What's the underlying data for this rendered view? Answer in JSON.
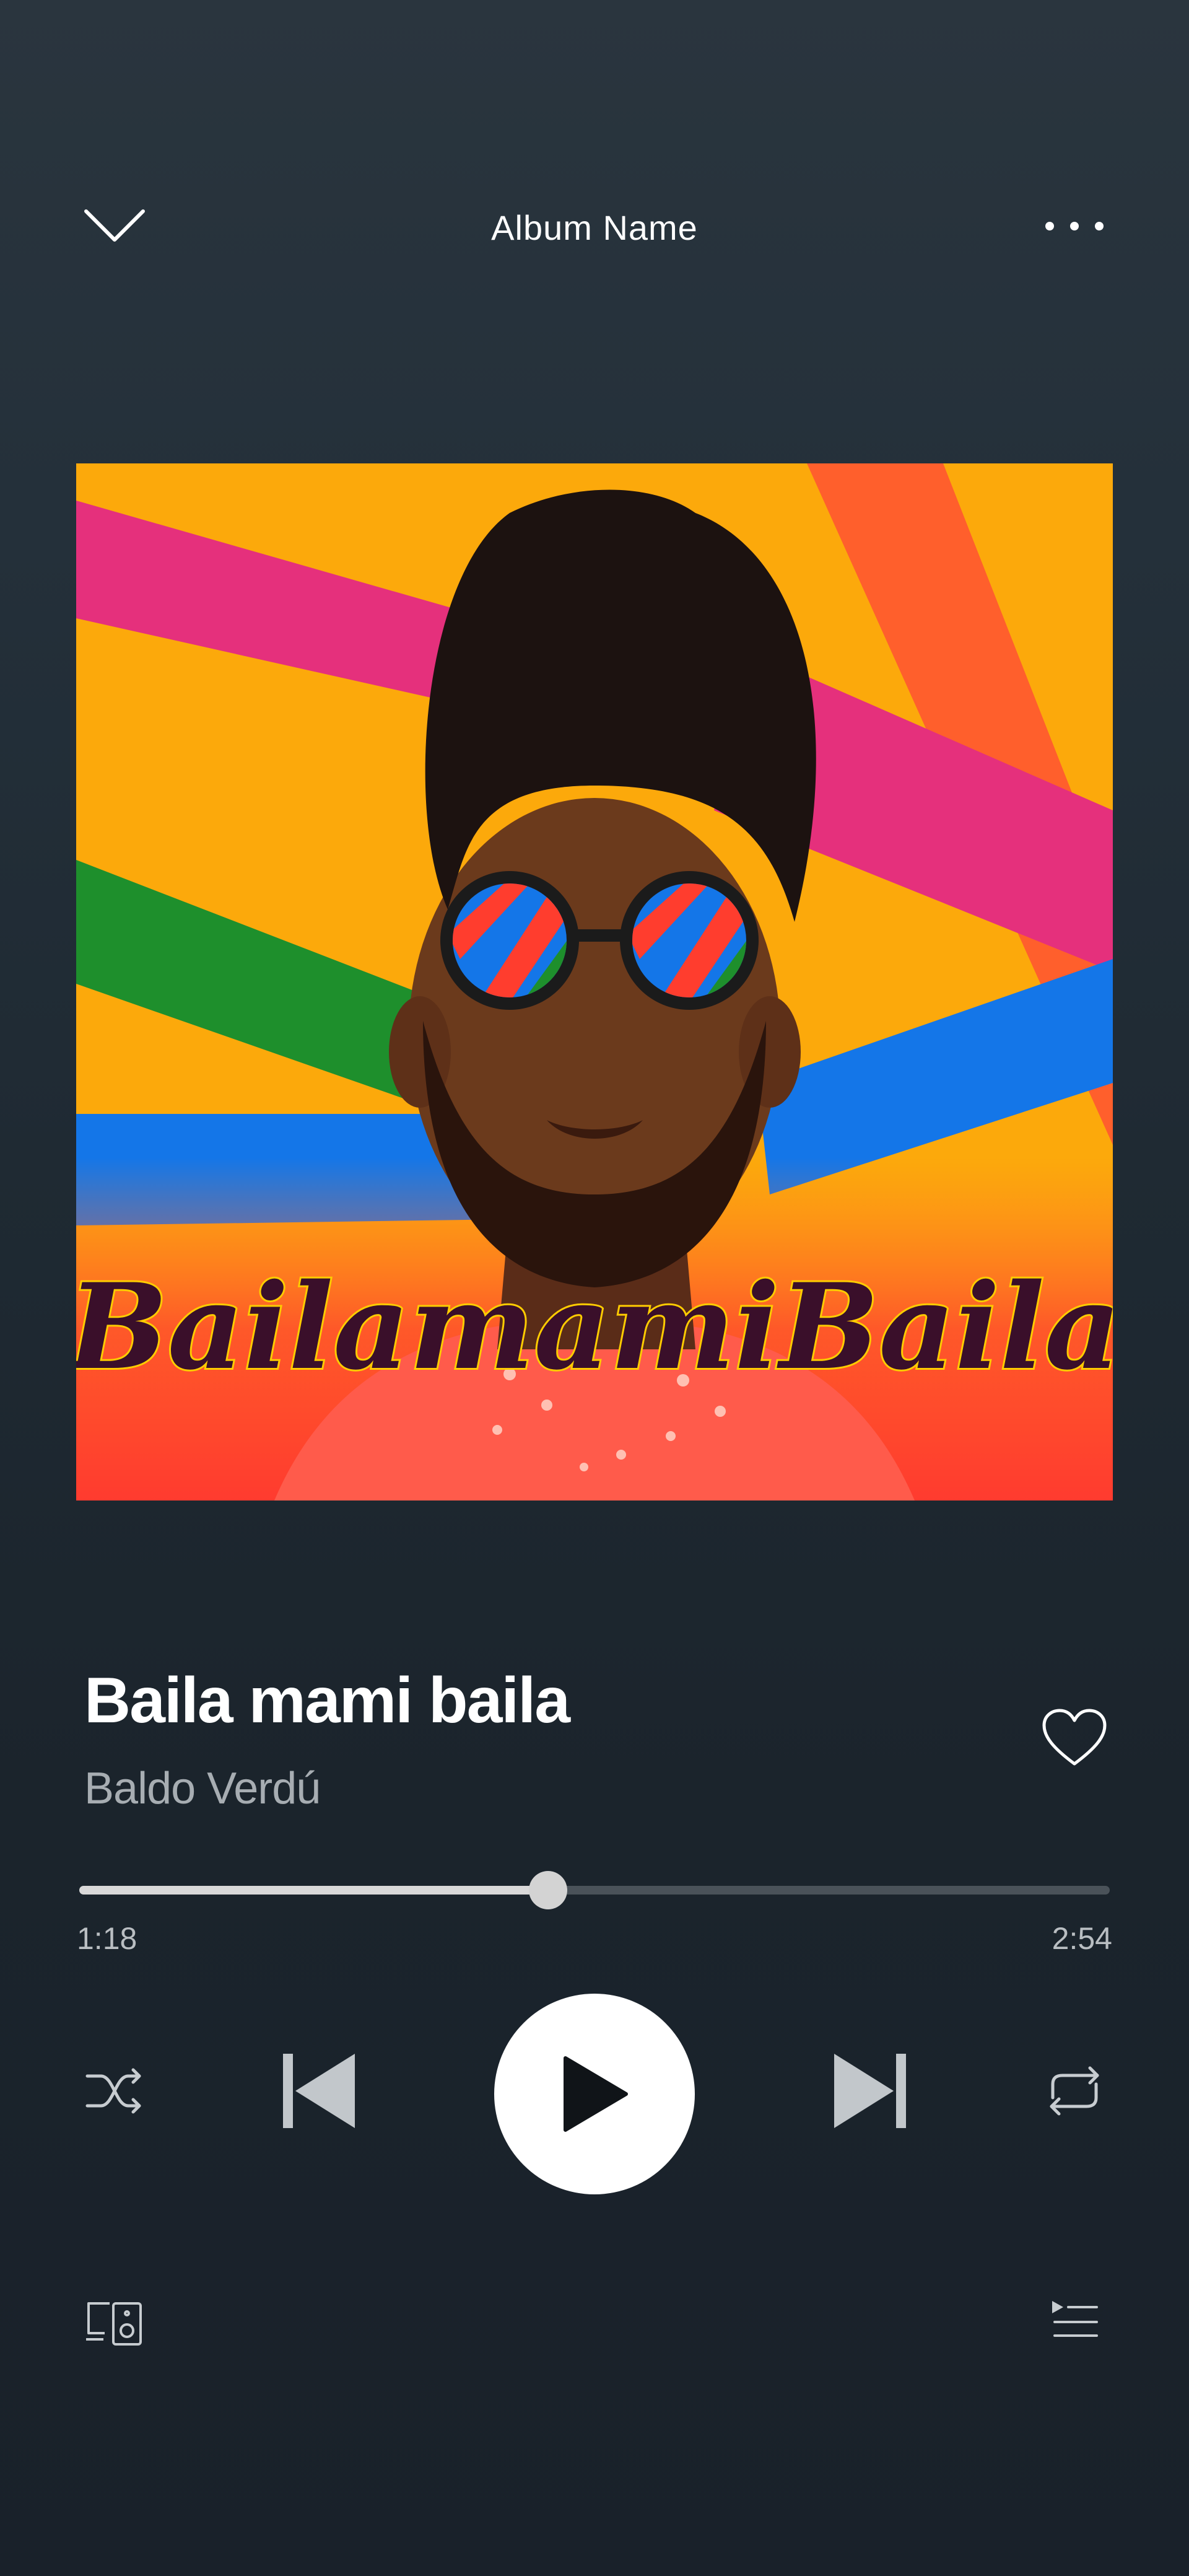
{
  "header": {
    "album_title": "Album Name",
    "collapse_icon": "chevron-down-icon",
    "more_icon": "more-horizontal-icon"
  },
  "artwork": {
    "text_line": "BailamamiBaila",
    "background_color": "#fca90b",
    "stripe_colors": [
      "#e5307c",
      "#1e8f2c",
      "#1476e8",
      "#ff3d2e"
    ]
  },
  "track": {
    "title": "Baila mami baila",
    "artist": "Baldo Verdú",
    "liked": false
  },
  "playback": {
    "elapsed": "1:18",
    "duration": "2:54",
    "progress_fraction": 0.455,
    "is_playing": false
  },
  "controls": {
    "shuffle_icon": "shuffle-icon",
    "previous_icon": "skip-previous-icon",
    "play_icon": "play-icon",
    "next_icon": "skip-next-icon",
    "repeat_icon": "repeat-icon",
    "devices_icon": "devices-icon",
    "queue_icon": "queue-icon"
  },
  "colors": {
    "background_top": "#2a353e",
    "background_bottom": "#19212a",
    "text_primary": "#ffffff",
    "text_secondary": "#a7adb2",
    "progress_fill": "#d9d9d9",
    "progress_track": "#4a5259"
  }
}
